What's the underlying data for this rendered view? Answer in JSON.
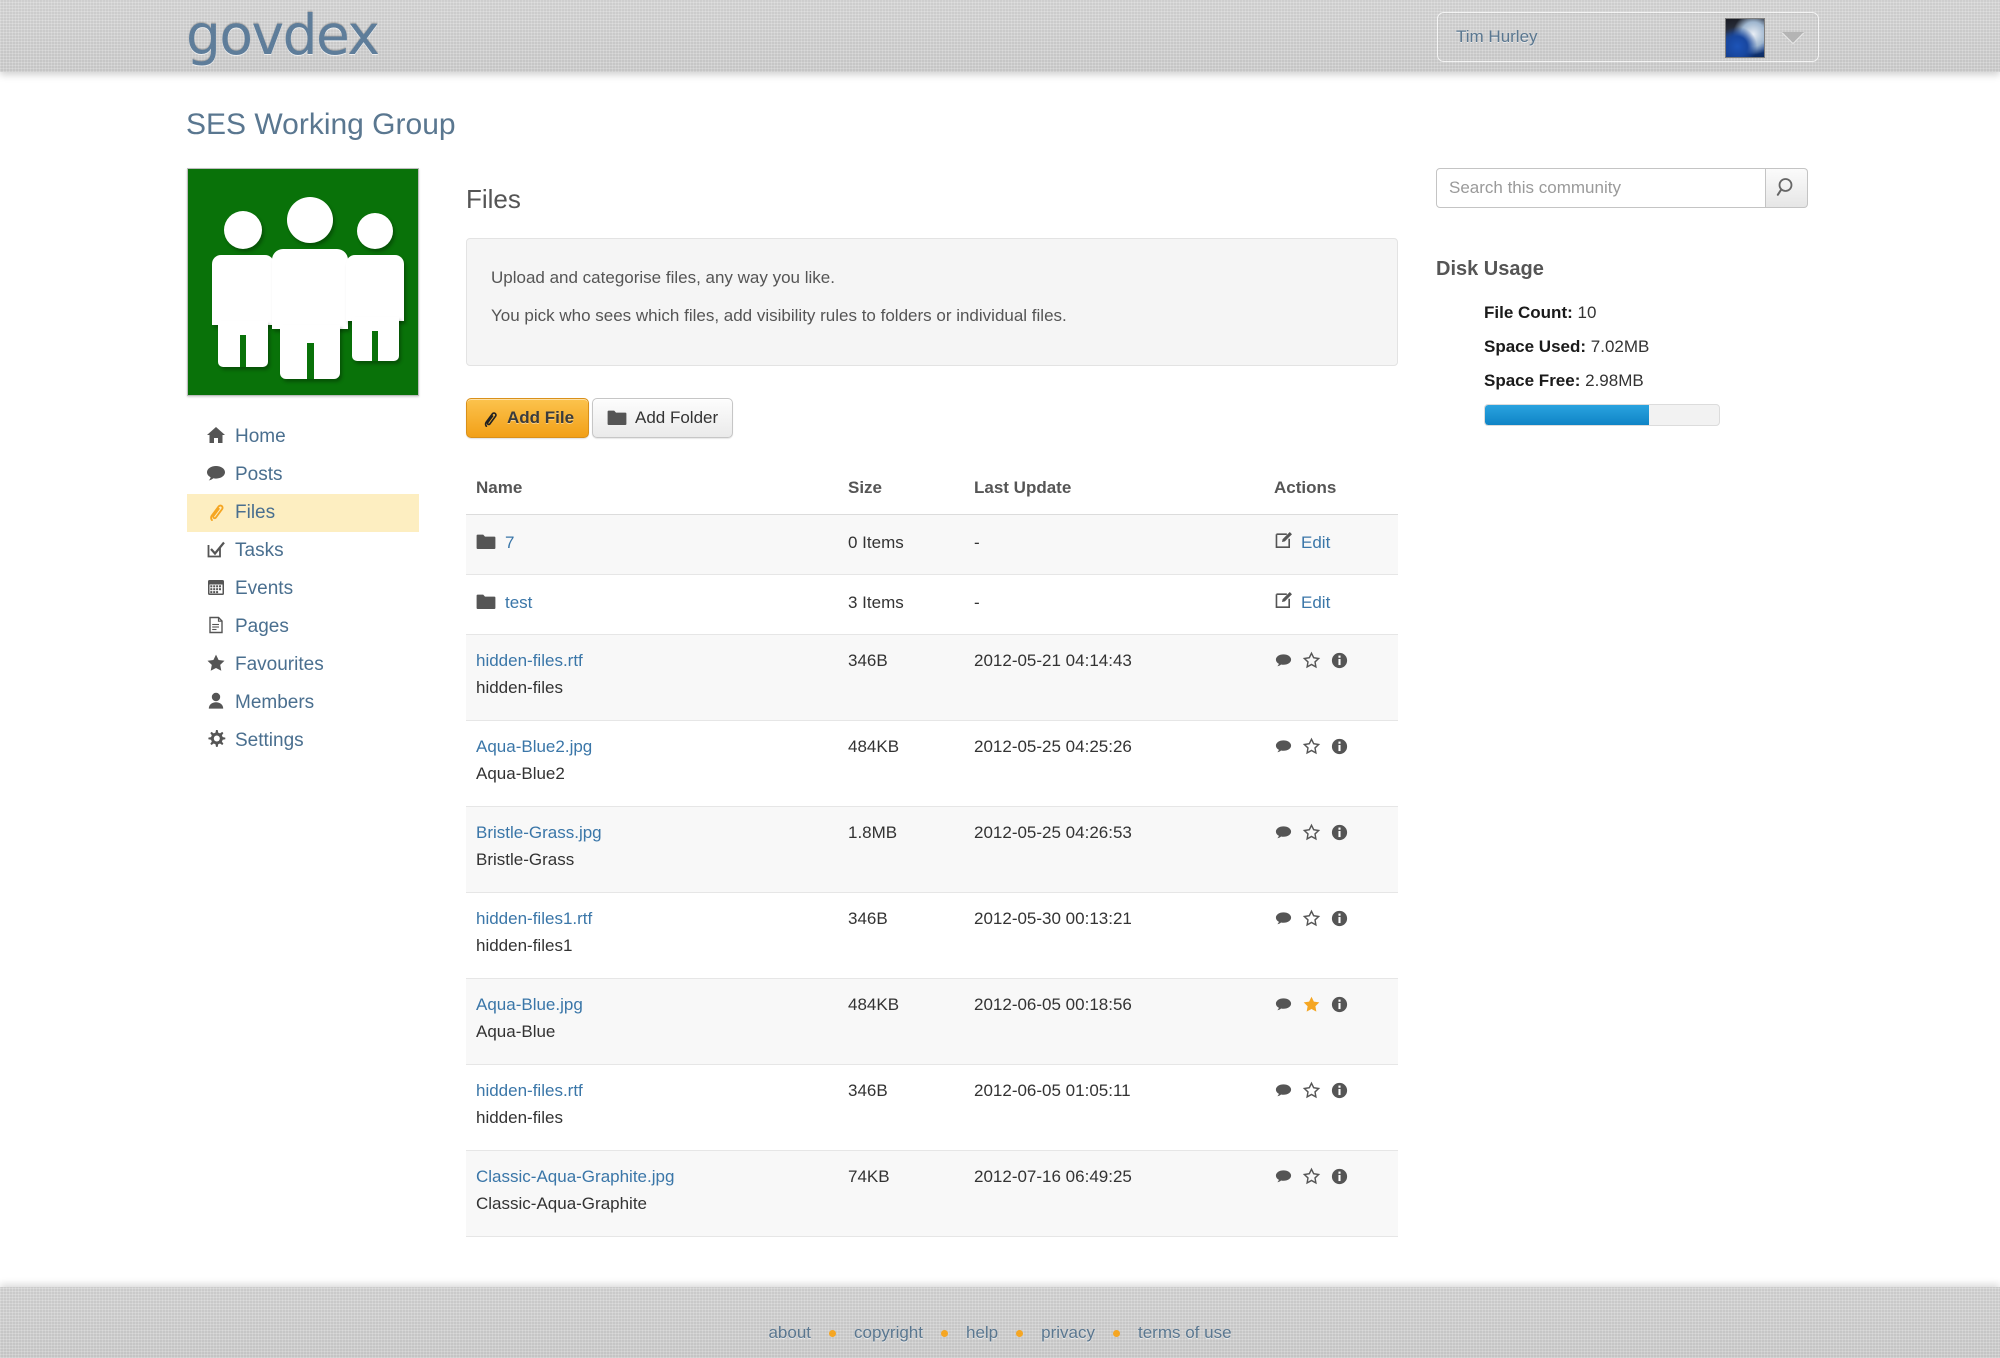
{
  "header": {
    "logo_text": "govdex",
    "user_name": "Tim Hurley",
    "avatar_icon": "car-avatar-image",
    "caret_icon": "chevron-down-icon"
  },
  "page": {
    "title": "SES Working Group",
    "group_avatar_icon": "three-people-group-icon"
  },
  "sidebar": {
    "items": [
      {
        "label": "Home",
        "icon": "home-icon",
        "active": false
      },
      {
        "label": "Posts",
        "icon": "comment-icon",
        "active": false
      },
      {
        "label": "Files",
        "icon": "paperclip-icon",
        "active": true
      },
      {
        "label": "Tasks",
        "icon": "checkbox-icon",
        "active": false
      },
      {
        "label": "Events",
        "icon": "calendar-icon",
        "active": false
      },
      {
        "label": "Pages",
        "icon": "document-icon",
        "active": false
      },
      {
        "label": "Favourites",
        "icon": "star-icon",
        "active": false
      },
      {
        "label": "Members",
        "icon": "person-icon",
        "active": false
      },
      {
        "label": "Settings",
        "icon": "gear-icon",
        "active": false
      }
    ]
  },
  "main": {
    "heading": "Files",
    "info_line_1": "Upload and categorise files, any way you like.",
    "info_line_2": "You pick who sees which files, add visibility rules to folders or individual files.",
    "add_file_label": "Add File",
    "add_file_icon": "paperclip-icon",
    "add_folder_label": "Add Folder",
    "add_folder_icon": "folder-icon",
    "columns": {
      "name": "Name",
      "size": "Size",
      "last_update": "Last Update",
      "actions": "Actions"
    },
    "edit_label": "Edit",
    "rows": [
      {
        "type": "folder",
        "name": "7",
        "desc": "",
        "size": "0 Items",
        "last_update": "-",
        "starred": false
      },
      {
        "type": "folder",
        "name": "test",
        "desc": "",
        "size": "3 Items",
        "last_update": "-",
        "starred": false
      },
      {
        "type": "file",
        "name": "hidden-files.rtf",
        "desc": "hidden-files",
        "size": "346B",
        "last_update": "2012-05-21 04:14:43",
        "starred": false
      },
      {
        "type": "file",
        "name": "Aqua-Blue2.jpg",
        "desc": "Aqua-Blue2",
        "size": "484KB",
        "last_update": "2012-05-25 04:25:26",
        "starred": false
      },
      {
        "type": "file",
        "name": "Bristle-Grass.jpg",
        "desc": "Bristle-Grass",
        "size": "1.8MB",
        "last_update": "2012-05-25 04:26:53",
        "starred": false
      },
      {
        "type": "file",
        "name": "hidden-files1.rtf",
        "desc": "hidden-files1",
        "size": "346B",
        "last_update": "2012-05-30 00:13:21",
        "starred": false
      },
      {
        "type": "file",
        "name": "Aqua-Blue.jpg",
        "desc": "Aqua-Blue",
        "size": "484KB",
        "last_update": "2012-06-05 00:18:56",
        "starred": true
      },
      {
        "type": "file",
        "name": "hidden-files.rtf",
        "desc": "hidden-files",
        "size": "346B",
        "last_update": "2012-06-05 01:05:11",
        "starred": false
      },
      {
        "type": "file",
        "name": "Classic-Aqua-Graphite.jpg",
        "desc": "Classic-Aqua-Graphite",
        "size": "74KB",
        "last_update": "2012-07-16 06:49:25",
        "starred": false
      }
    ]
  },
  "search": {
    "placeholder": "Search this community",
    "value": "",
    "button_icon": "search-icon"
  },
  "disk_usage": {
    "title": "Disk Usage",
    "file_count_label": "File Count:",
    "file_count_value": "10",
    "space_used_label": "Space Used:",
    "space_used_value": "7.02MB",
    "space_free_label": "Space Free:",
    "space_free_value": "2.98MB",
    "used_percent": 70,
    "bar_color": "#0f84c6"
  },
  "footer": {
    "links": [
      "about",
      "copyright",
      "help",
      "privacy",
      "terms of use"
    ],
    "separator_color": "#f5a623"
  },
  "colors": {
    "accent_orange": "#f5a623",
    "link_blue": "#3a76a8",
    "brand_blue": "#5a7790",
    "group_green": "#097209"
  }
}
